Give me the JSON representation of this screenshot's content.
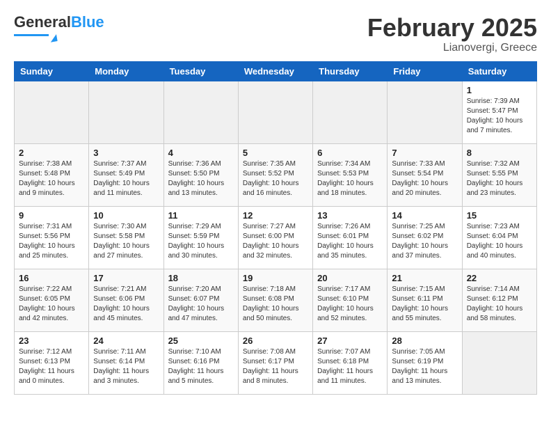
{
  "header": {
    "logo_general": "General",
    "logo_blue": "Blue",
    "month_title": "February 2025",
    "location": "Lianovergi, Greece"
  },
  "days_of_week": [
    "Sunday",
    "Monday",
    "Tuesday",
    "Wednesday",
    "Thursday",
    "Friday",
    "Saturday"
  ],
  "weeks": [
    [
      {
        "day": "",
        "info": ""
      },
      {
        "day": "",
        "info": ""
      },
      {
        "day": "",
        "info": ""
      },
      {
        "day": "",
        "info": ""
      },
      {
        "day": "",
        "info": ""
      },
      {
        "day": "",
        "info": ""
      },
      {
        "day": "1",
        "info": "Sunrise: 7:39 AM\nSunset: 5:47 PM\nDaylight: 10 hours and 7 minutes."
      }
    ],
    [
      {
        "day": "2",
        "info": "Sunrise: 7:38 AM\nSunset: 5:48 PM\nDaylight: 10 hours and 9 minutes."
      },
      {
        "day": "3",
        "info": "Sunrise: 7:37 AM\nSunset: 5:49 PM\nDaylight: 10 hours and 11 minutes."
      },
      {
        "day": "4",
        "info": "Sunrise: 7:36 AM\nSunset: 5:50 PM\nDaylight: 10 hours and 13 minutes."
      },
      {
        "day": "5",
        "info": "Sunrise: 7:35 AM\nSunset: 5:52 PM\nDaylight: 10 hours and 16 minutes."
      },
      {
        "day": "6",
        "info": "Sunrise: 7:34 AM\nSunset: 5:53 PM\nDaylight: 10 hours and 18 minutes."
      },
      {
        "day": "7",
        "info": "Sunrise: 7:33 AM\nSunset: 5:54 PM\nDaylight: 10 hours and 20 minutes."
      },
      {
        "day": "8",
        "info": "Sunrise: 7:32 AM\nSunset: 5:55 PM\nDaylight: 10 hours and 23 minutes."
      }
    ],
    [
      {
        "day": "9",
        "info": "Sunrise: 7:31 AM\nSunset: 5:56 PM\nDaylight: 10 hours and 25 minutes."
      },
      {
        "day": "10",
        "info": "Sunrise: 7:30 AM\nSunset: 5:58 PM\nDaylight: 10 hours and 27 minutes."
      },
      {
        "day": "11",
        "info": "Sunrise: 7:29 AM\nSunset: 5:59 PM\nDaylight: 10 hours and 30 minutes."
      },
      {
        "day": "12",
        "info": "Sunrise: 7:27 AM\nSunset: 6:00 PM\nDaylight: 10 hours and 32 minutes."
      },
      {
        "day": "13",
        "info": "Sunrise: 7:26 AM\nSunset: 6:01 PM\nDaylight: 10 hours and 35 minutes."
      },
      {
        "day": "14",
        "info": "Sunrise: 7:25 AM\nSunset: 6:02 PM\nDaylight: 10 hours and 37 minutes."
      },
      {
        "day": "15",
        "info": "Sunrise: 7:23 AM\nSunset: 6:04 PM\nDaylight: 10 hours and 40 minutes."
      }
    ],
    [
      {
        "day": "16",
        "info": "Sunrise: 7:22 AM\nSunset: 6:05 PM\nDaylight: 10 hours and 42 minutes."
      },
      {
        "day": "17",
        "info": "Sunrise: 7:21 AM\nSunset: 6:06 PM\nDaylight: 10 hours and 45 minutes."
      },
      {
        "day": "18",
        "info": "Sunrise: 7:20 AM\nSunset: 6:07 PM\nDaylight: 10 hours and 47 minutes."
      },
      {
        "day": "19",
        "info": "Sunrise: 7:18 AM\nSunset: 6:08 PM\nDaylight: 10 hours and 50 minutes."
      },
      {
        "day": "20",
        "info": "Sunrise: 7:17 AM\nSunset: 6:10 PM\nDaylight: 10 hours and 52 minutes."
      },
      {
        "day": "21",
        "info": "Sunrise: 7:15 AM\nSunset: 6:11 PM\nDaylight: 10 hours and 55 minutes."
      },
      {
        "day": "22",
        "info": "Sunrise: 7:14 AM\nSunset: 6:12 PM\nDaylight: 10 hours and 58 minutes."
      }
    ],
    [
      {
        "day": "23",
        "info": "Sunrise: 7:12 AM\nSunset: 6:13 PM\nDaylight: 11 hours and 0 minutes."
      },
      {
        "day": "24",
        "info": "Sunrise: 7:11 AM\nSunset: 6:14 PM\nDaylight: 11 hours and 3 minutes."
      },
      {
        "day": "25",
        "info": "Sunrise: 7:10 AM\nSunset: 6:16 PM\nDaylight: 11 hours and 5 minutes."
      },
      {
        "day": "26",
        "info": "Sunrise: 7:08 AM\nSunset: 6:17 PM\nDaylight: 11 hours and 8 minutes."
      },
      {
        "day": "27",
        "info": "Sunrise: 7:07 AM\nSunset: 6:18 PM\nDaylight: 11 hours and 11 minutes."
      },
      {
        "day": "28",
        "info": "Sunrise: 7:05 AM\nSunset: 6:19 PM\nDaylight: 11 hours and 13 minutes."
      },
      {
        "day": "",
        "info": ""
      }
    ]
  ]
}
